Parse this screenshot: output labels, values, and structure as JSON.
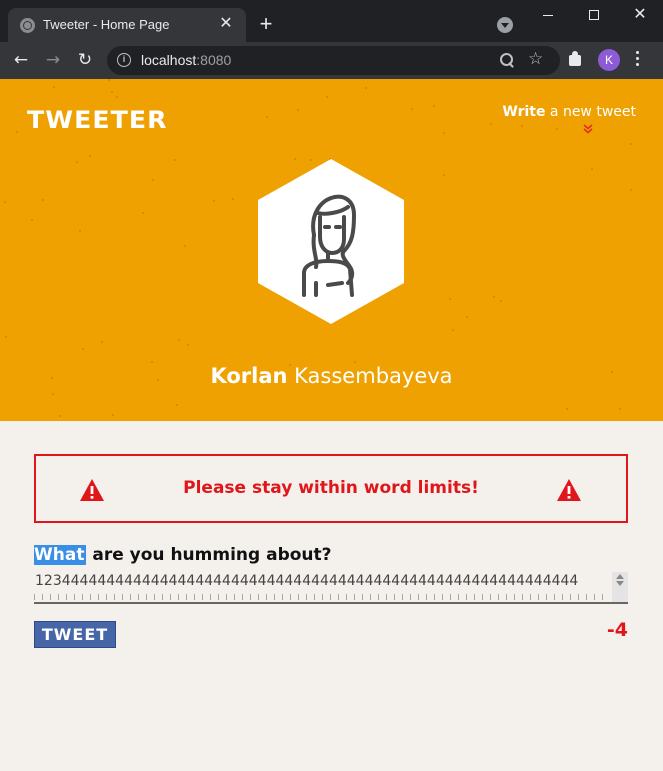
{
  "browser": {
    "tab_title": "Tweeter - Home Page",
    "tab_close": "✕",
    "new_tab": "+",
    "close_window": "✕",
    "url_host": "localhost",
    "url_port": ":8080",
    "info_glyph": "i",
    "star_glyph": "☆",
    "back_glyph": "←",
    "forward_glyph": "→",
    "reload_glyph": "↻",
    "profile_initial": "K",
    "profile_color": "#8e5bd6"
  },
  "header": {
    "logo": "TWEETER",
    "compose_bold": "Write",
    "compose_rest": " a new tweet",
    "compose_arrow": "»",
    "user_first": "Korlan",
    "user_last": " Kassembayeva",
    "avatar_icon": "user-hexagon-avatar",
    "background_color": "#f0a102"
  },
  "error": {
    "message": "Please stay within word limits!",
    "icon": "warning-triangle-icon",
    "color": "#e0161b"
  },
  "composer": {
    "label_highlighted": "What",
    "label_rest": " are you humming about?",
    "text": "1234444444444444444444444444444444444444444444444444444444444",
    "button_label": "TWEET",
    "counter": "-4"
  }
}
